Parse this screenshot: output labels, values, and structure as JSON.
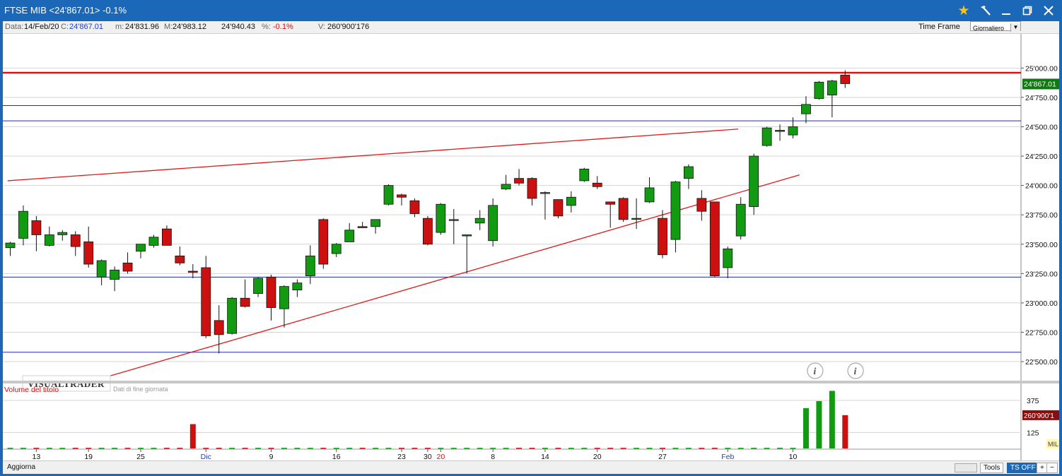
{
  "window": {
    "title": "FTSE MIB <24'867.01> -0.1%"
  },
  "toolbar_icons": [
    "star-icon",
    "hammer-icon",
    "minimize-icon",
    "maximize-icon",
    "close-icon"
  ],
  "info": {
    "date_label": "Data:",
    "date": "14/Feb/20",
    "close_label": "C:",
    "close": "24'867.01",
    "min_label": "m:",
    "min": "24'831.96",
    "max_label": "M:",
    "max": "24'983.12",
    "open": "24'940.43",
    "pct_label": "%:",
    "pct": "-0.1%",
    "vol_label": "V:",
    "vol": "260'900'176",
    "timeframe_label": "Time Frame",
    "timeframe_value": "Giornaliero"
  },
  "status": {
    "refresh": "Aggiorna",
    "tools": "Tools",
    "ts": "TS OFF",
    "plus": "+",
    "minus": "−"
  },
  "colors": {
    "up": "#139a13",
    "down": "#cc1010",
    "hline_blue": "#1f2fa0",
    "hline_red": "#dd1010",
    "trend": "#e01818"
  },
  "chart_data": {
    "type": "candlestick",
    "instrument": "FTSE MIB",
    "ylim": [
      22380,
      25050
    ],
    "y_ticks": [
      "25'000.00",
      "24'750.00",
      "24'500.00",
      "24'250.00",
      "24'000.00",
      "23'750.00",
      "23'500.00",
      "23'250.00",
      "23'000.00",
      "22'750.00",
      "22'500.00"
    ],
    "last_price_label": "24'867.01",
    "x_labels": [
      {
        "bar": 2,
        "text": "13",
        "red": false
      },
      {
        "bar": 6,
        "text": "19",
        "red": false
      },
      {
        "bar": 10,
        "text": "25",
        "red": false
      },
      {
        "bar": 15,
        "text": "Dic",
        "red": false,
        "accent": true
      },
      {
        "bar": 20,
        "text": "9",
        "red": false
      },
      {
        "bar": 25,
        "text": "16",
        "red": false
      },
      {
        "bar": 30,
        "text": "23",
        "red": false
      },
      {
        "bar": 32,
        "text": "30",
        "red": false
      },
      {
        "bar": 33,
        "text": "20",
        "red": true
      },
      {
        "bar": 37,
        "text": "8",
        "red": false
      },
      {
        "bar": 41,
        "text": "14",
        "red": false
      },
      {
        "bar": 45,
        "text": "20",
        "red": false
      },
      {
        "bar": 50,
        "text": "27",
        "red": false
      },
      {
        "bar": 55,
        "text": "Feb",
        "red": false,
        "accent": true
      },
      {
        "bar": 60,
        "text": "10",
        "red": false
      }
    ],
    "candles": [
      {
        "o": 23470,
        "h": 23520,
        "l": 23400,
        "c": 23510
      },
      {
        "o": 23550,
        "h": 23830,
        "l": 23490,
        "c": 23780
      },
      {
        "o": 23700,
        "h": 23740,
        "l": 23440,
        "c": 23580
      },
      {
        "o": 23490,
        "h": 23650,
        "l": 23480,
        "c": 23580
      },
      {
        "o": 23580,
        "h": 23620,
        "l": 23530,
        "c": 23600
      },
      {
        "o": 23580,
        "h": 23610,
        "l": 23400,
        "c": 23480
      },
      {
        "o": 23520,
        "h": 23650,
        "l": 23300,
        "c": 23330
      },
      {
        "o": 23220,
        "h": 23370,
        "l": 23150,
        "c": 23360
      },
      {
        "o": 23200,
        "h": 23310,
        "l": 23100,
        "c": 23280
      },
      {
        "o": 23340,
        "h": 23430,
        "l": 23250,
        "c": 23270
      },
      {
        "o": 23440,
        "h": 23500,
        "l": 23380,
        "c": 23500
      },
      {
        "o": 23490,
        "h": 23580,
        "l": 23470,
        "c": 23560
      },
      {
        "o": 23630,
        "h": 23660,
        "l": 23490,
        "c": 23490
      },
      {
        "o": 23400,
        "h": 23480,
        "l": 23320,
        "c": 23340
      },
      {
        "o": 23270,
        "h": 23330,
        "l": 23210,
        "c": 23260
      },
      {
        "o": 23300,
        "h": 23400,
        "l": 22700,
        "c": 22720
      },
      {
        "o": 22850,
        "h": 22980,
        "l": 22570,
        "c": 22730
      },
      {
        "o": 22740,
        "h": 23050,
        "l": 22730,
        "c": 23040
      },
      {
        "o": 23040,
        "h": 23200,
        "l": 22960,
        "c": 22970
      },
      {
        "o": 23080,
        "h": 23220,
        "l": 23050,
        "c": 23210
      },
      {
        "o": 23220,
        "h": 23240,
        "l": 22850,
        "c": 22960
      },
      {
        "o": 22950,
        "h": 23150,
        "l": 22790,
        "c": 23140
      },
      {
        "o": 23110,
        "h": 23200,
        "l": 23050,
        "c": 23170
      },
      {
        "o": 23230,
        "h": 23490,
        "l": 23160,
        "c": 23400
      },
      {
        "o": 23710,
        "h": 23720,
        "l": 23290,
        "c": 23330
      },
      {
        "o": 23420,
        "h": 23510,
        "l": 23390,
        "c": 23500
      },
      {
        "o": 23520,
        "h": 23680,
        "l": 23520,
        "c": 23620
      },
      {
        "o": 23650,
        "h": 23690,
        "l": 23640,
        "c": 23640
      },
      {
        "o": 23650,
        "h": 23700,
        "l": 23590,
        "c": 23710
      },
      {
        "o": 23840,
        "h": 24010,
        "l": 23830,
        "c": 24000
      },
      {
        "o": 23920,
        "h": 23930,
        "l": 23830,
        "c": 23900
      },
      {
        "o": 23870,
        "h": 23890,
        "l": 23730,
        "c": 23760
      },
      {
        "o": 23720,
        "h": 23740,
        "l": 23490,
        "c": 23500
      },
      {
        "o": 23600,
        "h": 23850,
        "l": 23580,
        "c": 23840
      },
      {
        "o": 23710,
        "h": 23800,
        "l": 23500,
        "c": 23710
      },
      {
        "o": 23570,
        "h": 23580,
        "l": 23250,
        "c": 23580
      },
      {
        "o": 23680,
        "h": 23790,
        "l": 23620,
        "c": 23720
      },
      {
        "o": 23530,
        "h": 23890,
        "l": 23480,
        "c": 23830
      },
      {
        "o": 23970,
        "h": 24090,
        "l": 23960,
        "c": 24010
      },
      {
        "o": 24060,
        "h": 24140,
        "l": 24000,
        "c": 24020
      },
      {
        "o": 24060,
        "h": 24070,
        "l": 23830,
        "c": 23890
      },
      {
        "o": 23940,
        "h": 23950,
        "l": 23710,
        "c": 23940
      },
      {
        "o": 23880,
        "h": 23880,
        "l": 23720,
        "c": 23740
      },
      {
        "o": 23830,
        "h": 23950,
        "l": 23770,
        "c": 23900
      },
      {
        "o": 24040,
        "h": 24150,
        "l": 24030,
        "c": 24140
      },
      {
        "o": 24020,
        "h": 24080,
        "l": 23970,
        "c": 23990
      },
      {
        "o": 23860,
        "h": 23860,
        "l": 23640,
        "c": 23840
      },
      {
        "o": 23890,
        "h": 23900,
        "l": 23690,
        "c": 23710
      },
      {
        "o": 23720,
        "h": 23890,
        "l": 23630,
        "c": 23720
      },
      {
        "o": 23860,
        "h": 24070,
        "l": 23850,
        "c": 23980
      },
      {
        "o": 23720,
        "h": 23790,
        "l": 23380,
        "c": 23410
      },
      {
        "o": 23540,
        "h": 24040,
        "l": 23430,
        "c": 24030
      },
      {
        "o": 24060,
        "h": 24180,
        "l": 23970,
        "c": 24160
      },
      {
        "o": 23890,
        "h": 23960,
        "l": 23700,
        "c": 23780
      },
      {
        "o": 23860,
        "h": 23860,
        "l": 23220,
        "c": 23230
      },
      {
        "o": 23300,
        "h": 23480,
        "l": 23210,
        "c": 23460
      },
      {
        "o": 23570,
        "h": 23900,
        "l": 23540,
        "c": 23840
      },
      {
        "o": 23820,
        "h": 24270,
        "l": 23750,
        "c": 24250
      },
      {
        "o": 24340,
        "h": 24500,
        "l": 24330,
        "c": 24490
      },
      {
        "o": 24460,
        "h": 24520,
        "l": 24380,
        "c": 24470
      },
      {
        "o": 24430,
        "h": 24580,
        "l": 24400,
        "c": 24500
      },
      {
        "o": 24610,
        "h": 24760,
        "l": 24530,
        "c": 24690
      },
      {
        "o": 24740,
        "h": 24890,
        "l": 24730,
        "c": 24880
      },
      {
        "o": 24770,
        "h": 24900,
        "l": 24580,
        "c": 24890
      },
      {
        "o": 24940,
        "h": 24980,
        "l": 24830,
        "c": 24867
      }
    ],
    "volume": {
      "label": "Volume del titolo",
      "ylim": [
        0,
        480
      ],
      "y_ticks": [
        "375",
        "125"
      ],
      "last_label": "260'900'1",
      "unit": "MIL",
      "values": [
        5,
        5,
        5,
        5,
        5,
        5,
        5,
        5,
        5,
        5,
        5,
        5,
        5,
        5,
        190,
        5,
        5,
        5,
        5,
        5,
        5,
        5,
        5,
        5,
        5,
        5,
        5,
        5,
        5,
        5,
        5,
        5,
        5,
        5,
        5,
        5,
        5,
        5,
        5,
        5,
        5,
        5,
        5,
        5,
        5,
        5,
        5,
        5,
        5,
        5,
        5,
        5,
        5,
        5,
        5,
        5,
        5,
        5,
        5,
        5,
        5,
        315,
        370,
        450,
        260
      ]
    },
    "horizontal_lines": [
      {
        "value": 24960,
        "color": "red"
      },
      {
        "value": 24680,
        "color": "blue"
      },
      {
        "value": 24550,
        "color": "blue"
      },
      {
        "value": 23220,
        "color": "blue"
      },
      {
        "value": 22580,
        "color": "blue"
      }
    ],
    "trend_lines": [
      {
        "from": [
          -0.2,
          24040
        ],
        "to": [
          55.8,
          24480
        ]
      },
      {
        "from": [
          7.7,
          22380
        ],
        "to": [
          60.5,
          24090
        ]
      }
    ],
    "watermark": "VISUALTRADER",
    "watermark_sub": "Dati di fine giornata"
  }
}
